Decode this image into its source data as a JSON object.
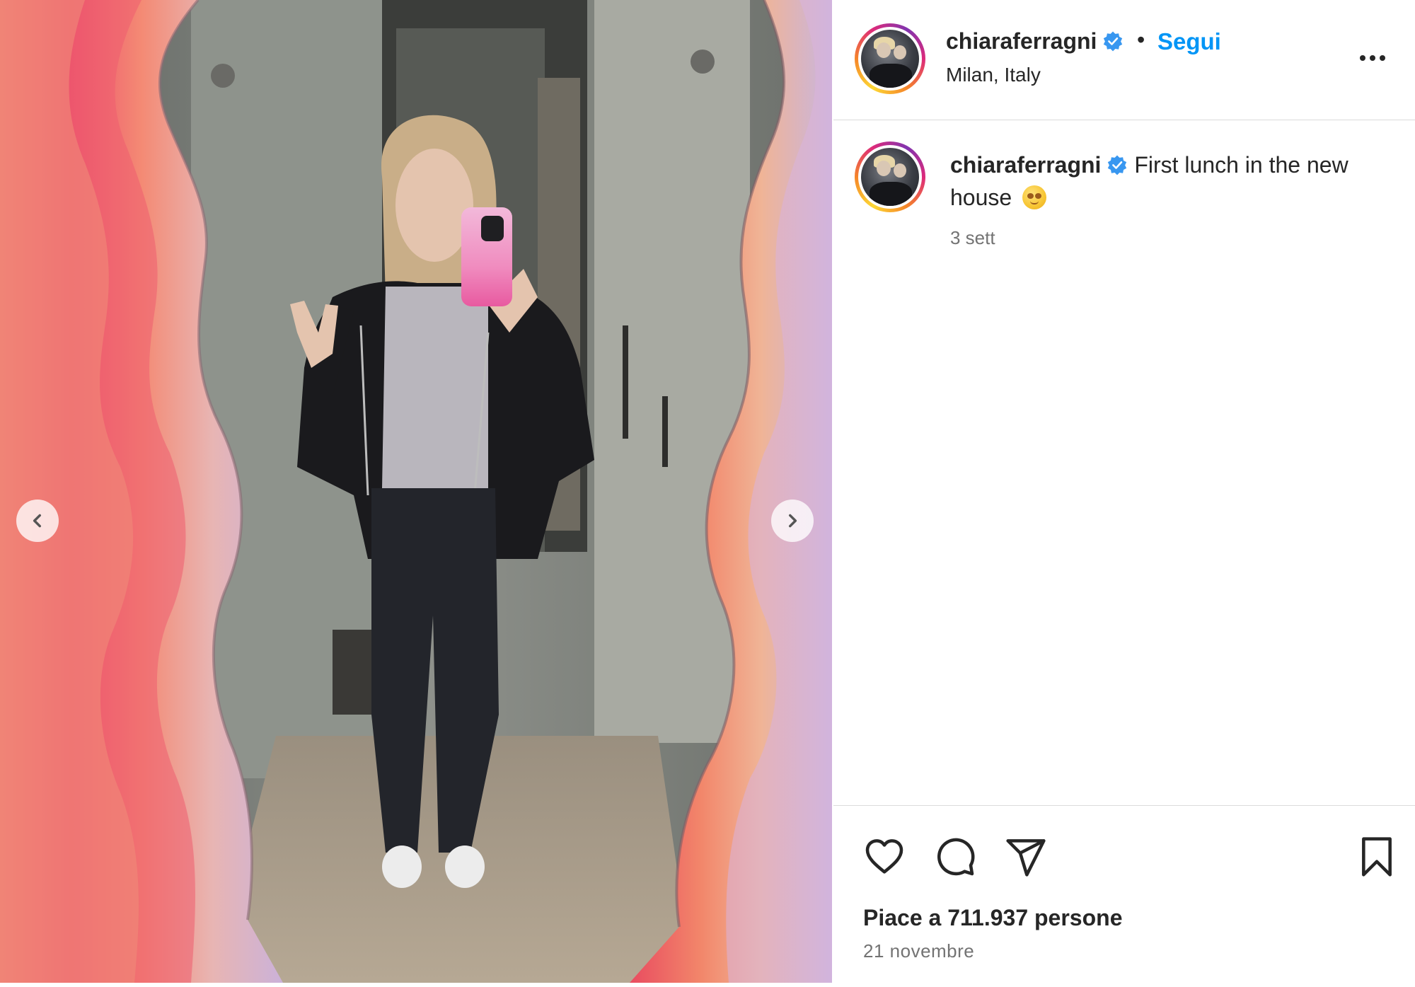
{
  "post": {
    "username": "chiaraferragni",
    "follow_label": "Segui",
    "separator": "•",
    "location": "Milan, Italy",
    "caption": {
      "username": "chiaraferragni",
      "text": "First lunch in the new house",
      "emoji": "🥹"
    },
    "time_ago": "3 sett",
    "likes_text": "Piace a 711.937 persone",
    "date": "21 novembre"
  },
  "icons": {
    "verified": "verified-badge-icon",
    "more": "more-options-icon",
    "like": "heart-icon",
    "comment": "comment-icon",
    "share": "paper-plane-icon",
    "save": "bookmark-icon",
    "prev": "chevron-left-icon",
    "next": "chevron-right-icon"
  },
  "colors": {
    "accent_blue": "#0095f6",
    "verified_blue": "#3897f0",
    "text_primary": "#262626",
    "text_secondary": "#737373",
    "divider": "#dbdbdb"
  }
}
